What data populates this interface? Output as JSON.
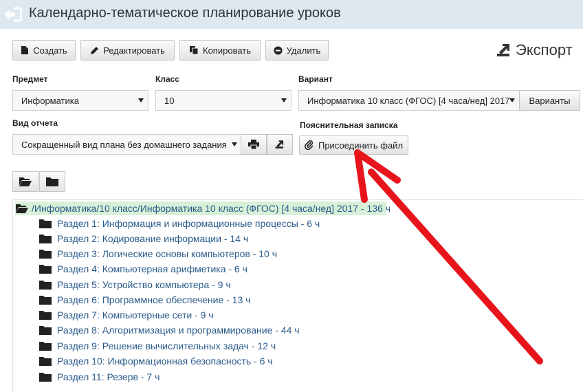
{
  "header": {
    "title": "Календарно-тематическое планирование уроков"
  },
  "toolbar": {
    "create": "Создать",
    "edit": "Редактировать",
    "copy": "Копировать",
    "delete": "Удалить",
    "export": "Экспорт"
  },
  "filters": {
    "subject_label": "Предмет",
    "subject_value": "Информатика",
    "class_label": "Класс",
    "class_value": "10",
    "variant_label": "Вариант",
    "variant_value": "Информатика 10 класс (ФГОС) [4 часа/нед] 2017",
    "variants_button": "Варианты",
    "report_label": "Вид отчета",
    "report_value": "Сокращенный вид плана без домашнего задания",
    "note_label": "Пояснительная записка",
    "attach_button": "Присоединить файл"
  },
  "tree": {
    "root": "/Информатика/10 класс/Информатика 10 класс (ФГОС) [4 часа/нед] 2017 - 136 ч",
    "sections": [
      "Раздел 1: Информация и информационные процессы - 6 ч",
      "Раздел 2: Кодирование информации - 14 ч",
      "Раздел 3: Логические основы компьютеров - 10 ч",
      "Раздел 4: Компьютерная арифметика - 6 ч",
      "Раздел 5: Устройство компьютера - 9 ч",
      "Раздел 6: Программное обеспечение - 13 ч",
      "Раздел 7: Компьютерные сети - 9 ч",
      "Раздел 8: Алгоритмизация и программирование - 44 ч",
      "Раздел 9: Решение вычислительных задач - 12 ч",
      "Раздел 10: Информационная безопасность - 6 ч",
      "Раздел 11: Резерв - 7 ч"
    ]
  },
  "colors": {
    "header_bg": "#dde8f1",
    "link": "#2a5a8a",
    "root_highlight": "#d8f0d8",
    "annotation_arrow": "#e8141c"
  }
}
